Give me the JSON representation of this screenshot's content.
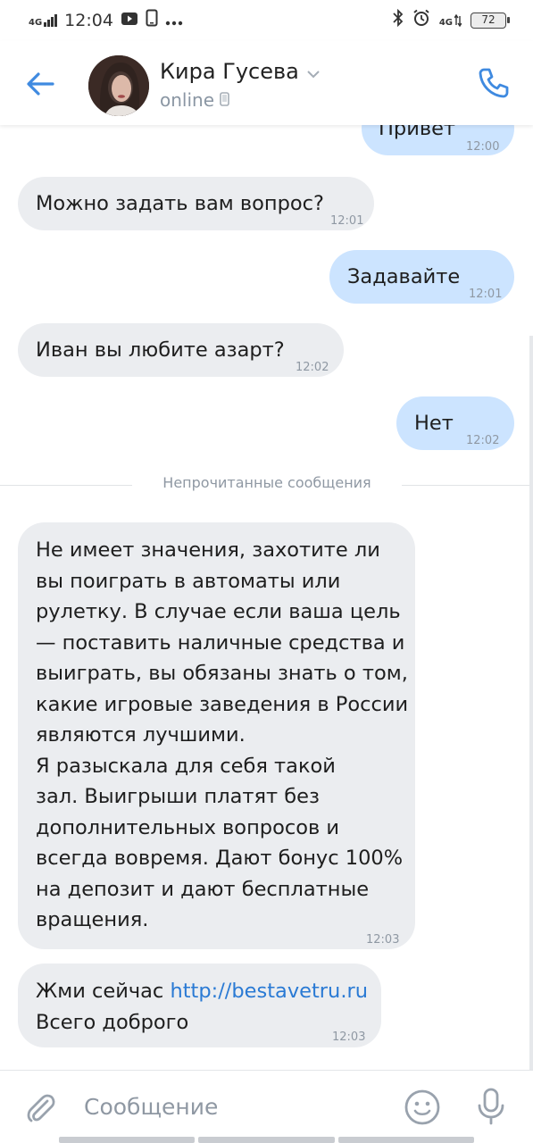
{
  "status_bar": {
    "network": "4G",
    "time": "12:04",
    "right_network": "4G",
    "battery": "72"
  },
  "header": {
    "contact_name": "Кира Гусева",
    "status": "online",
    "icons": [
      "back-arrow-icon",
      "chevron-down-icon",
      "mobile-device-icon",
      "phone-icon"
    ]
  },
  "messages": [
    {
      "direction": "out",
      "lines": [
        "Привет"
      ],
      "time": "12:00"
    },
    {
      "direction": "in",
      "lines": [
        "Можно задать вам вопрос?"
      ],
      "time": "12:01"
    },
    {
      "direction": "out",
      "lines": [
        "Задавайте"
      ],
      "time": "12:01"
    },
    {
      "direction": "in",
      "lines": [
        "Иван вы любите азарт?"
      ],
      "time": "12:02"
    },
    {
      "direction": "out",
      "lines": [
        "Нет"
      ],
      "time": "12:02"
    },
    {
      "direction": "in",
      "lines": [
        "Не имеет значения, захотите ли",
        "вы поиграть  в автоматы или",
        "рулетку. В случае если ваша цель",
        "— поставить наличные средства и",
        "выиграть, вы обязаны знать о том,",
        "какие игровые заведения в России",
        "являются лучшими.",
        "Я разыскала для себя такой",
        "зал. Выигрыши платят без",
        "дополнительных вопросов и",
        "всегда вовремя. Дают бонус 100%",
        "на депозит и дают бесплатные",
        "вращения."
      ],
      "time": "12:03"
    },
    {
      "direction": "in",
      "prefix": "Жми сейчас ",
      "link": "http://bestavetru.ru",
      "lines": [
        "Всего доброго"
      ],
      "time": "12:03"
    }
  ],
  "divider_label": "Непрочитанные сообщения",
  "composer": {
    "placeholder": "Сообщение",
    "icons": [
      "attach-icon",
      "emoji-icon",
      "microphone-icon"
    ]
  },
  "colors": {
    "accent": "#3f8ae0",
    "incoming_bubble": "#ebedf0",
    "outgoing_bubble": "#cce4ff",
    "link": "#2a7ad4"
  }
}
